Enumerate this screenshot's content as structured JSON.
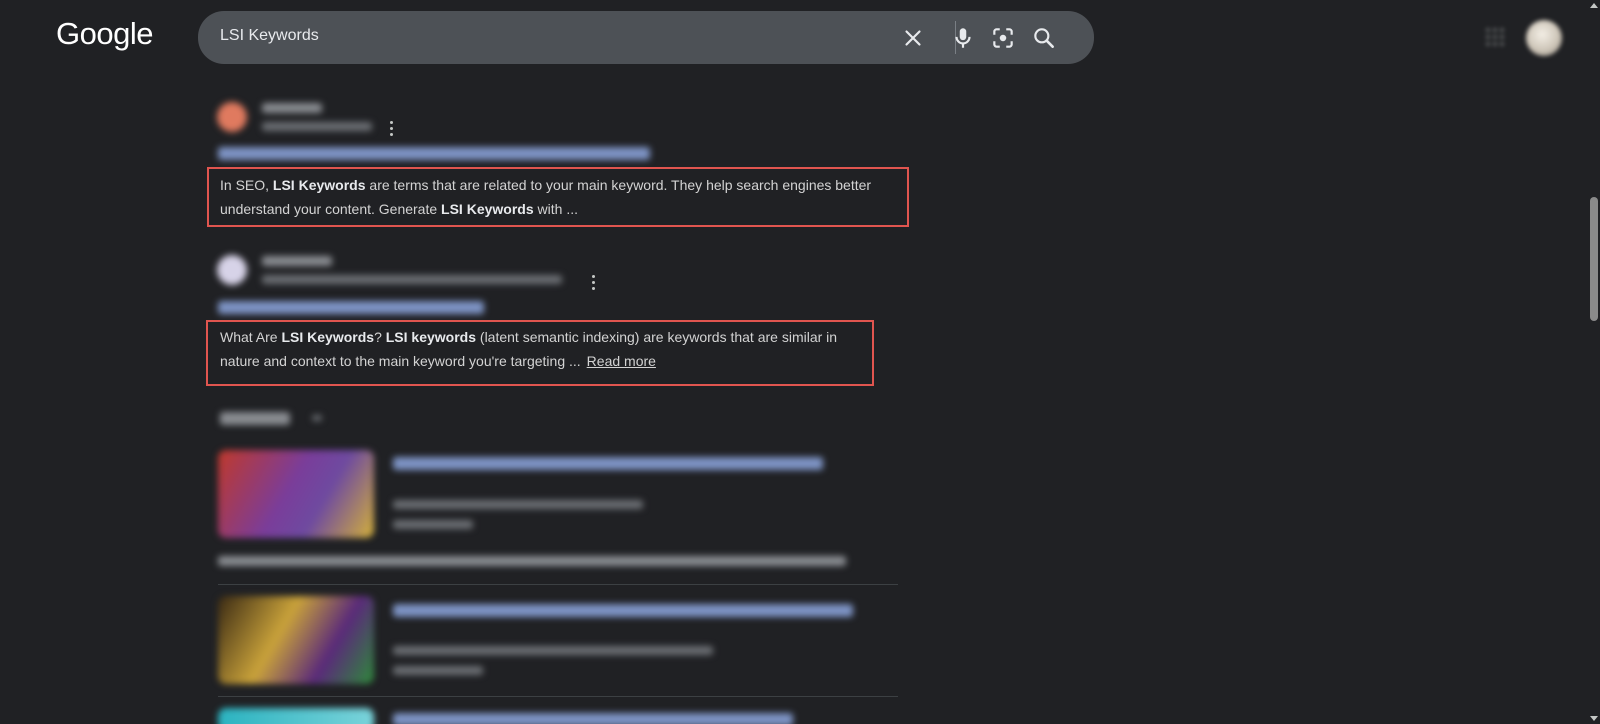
{
  "header": {
    "logo": "Google",
    "search": {
      "value": "LSI Keywords"
    },
    "icons": [
      "clear-icon",
      "microphone-icon",
      "lens-icon",
      "search-icon",
      "apps-icon",
      "avatar"
    ]
  },
  "results": [
    {
      "snippet": {
        "text1": "In SEO, ",
        "bold1": "LSI Keywords",
        "text2": " are terms that are related to your main keyword. They help search engines better",
        "text3": "understand your content. Generate ",
        "bold2": "LSI Keywords",
        "text4": " with ..."
      }
    },
    {
      "snippet": {
        "text1": "What Are ",
        "bold1": "LSI Keywords",
        "text2": "? ",
        "bold2": "LSI keywords",
        "text3": " (latent semantic indexing) are keywords that are similar in",
        "text4": "nature and context to the main keyword you're targeting ...",
        "read_more": "Read more"
      }
    }
  ],
  "colors": {
    "background": "#202124",
    "searchbar": "#4d5156",
    "highlight_border": "#e0554f",
    "link_blurred": "#7d93c4"
  }
}
